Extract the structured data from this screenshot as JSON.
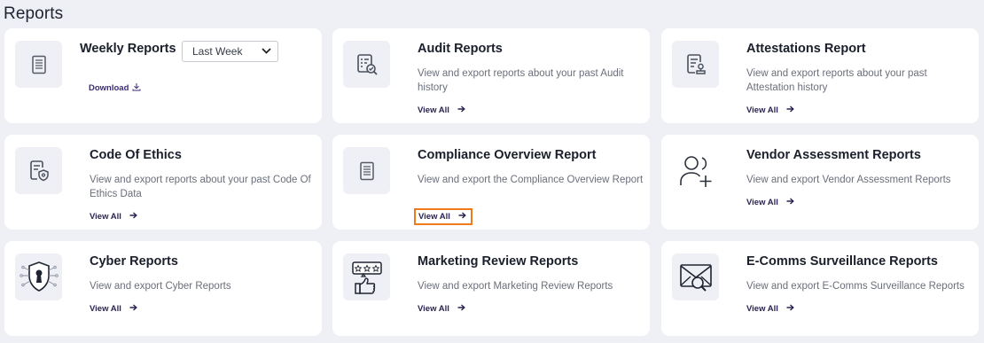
{
  "page": {
    "title": "Reports"
  },
  "colors": {
    "background": "#eef0f5",
    "card": "#ffffff",
    "link": "#2a2450",
    "highlight": "#f07b1a"
  },
  "weekly": {
    "title": "Weekly Reports",
    "period_selected": "Last Week",
    "download_label": "Download",
    "icon": "document-icon"
  },
  "cards": [
    {
      "title": "Audit Reports",
      "description": "View and export reports about your past Audit history",
      "link": "View All",
      "icon": "audit-search-icon"
    },
    {
      "title": "Attestations Report",
      "description": "View and export reports about your past Attestation history",
      "link": "View All",
      "icon": "attestation-document-icon"
    },
    {
      "title": "Code Of Ethics",
      "description": "View and export reports about your past Code Of Ethics Data",
      "link": "View All",
      "icon": "ethics-shield-document-icon"
    },
    {
      "title": "Compliance Overview Report",
      "description": "View and export the Compliance Overview Report",
      "link": "View All",
      "icon": "document-icon"
    },
    {
      "title": "Vendor Assessment Reports",
      "description": "View and export Vendor Assessment Reports",
      "link": "View All",
      "icon": "add-user-icon"
    },
    {
      "title": "Cyber Reports",
      "description": "View and export Cyber Reports",
      "link": "View All",
      "icon": "cyber-shield-icon"
    },
    {
      "title": "Marketing Review Reports",
      "description": "View and export Marketing Review Reports",
      "link": "View All",
      "icon": "rating-thumbs-up-icon"
    },
    {
      "title": "E-Comms Surveillance Reports",
      "description": "View and export E-Comms Surveillance Reports",
      "link": "View All",
      "icon": "envelope-search-icon"
    }
  ]
}
